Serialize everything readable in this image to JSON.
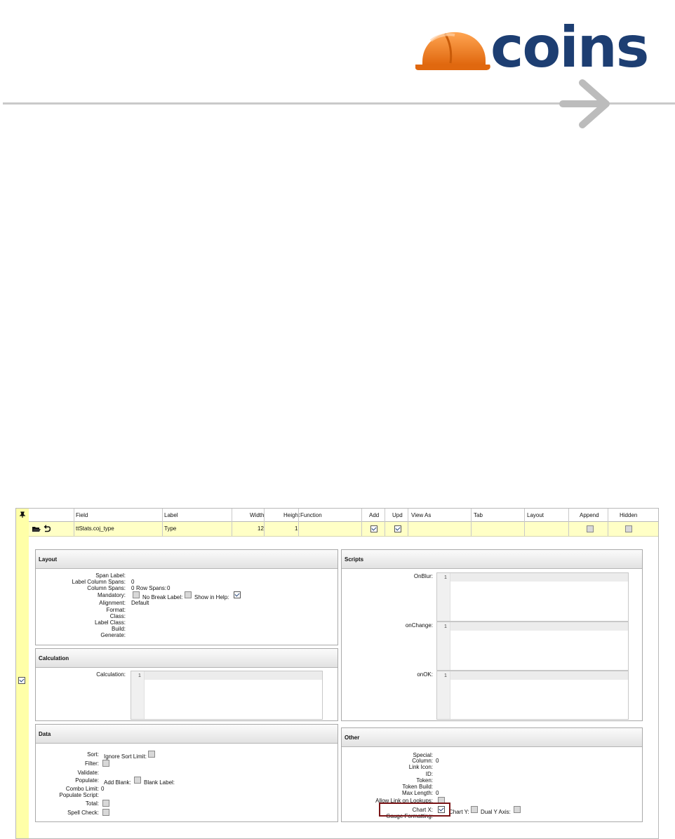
{
  "brand": {
    "logo_text": "coins",
    "accent": "#f07d1a",
    "navy": "#1d3e72"
  },
  "grid": {
    "columns": [
      "Field",
      "Label",
      "Width",
      "Height",
      "Function",
      "Add",
      "Upd",
      "View As",
      "Tab",
      "Layout",
      "Append",
      "Hidden"
    ],
    "row": {
      "field": "ttStats.coj_type",
      "label": "Type",
      "width": "12",
      "height": "1",
      "add": true,
      "upd": true,
      "append": false,
      "hidden": false
    }
  },
  "layout": {
    "title": "Layout",
    "span_label": "Span Label:",
    "label_col_spans": "Label Column Spans:",
    "label_col_spans_val": "0",
    "col_spans": "Column Spans:",
    "col_spans_val": "0",
    "row_spans": "Row Spans:",
    "row_spans_val": "0",
    "mandatory": "Mandatory:",
    "no_break": "No Break Label:",
    "show_help": "Show in Help:",
    "alignment": "Alignment:",
    "alignment_val": "Default",
    "format": "Format:",
    "class": "Class:",
    "label_class": "Label Class:",
    "build": "Build:",
    "generate": "Generate:"
  },
  "calculation": {
    "title": "Calculation",
    "label": "Calculation:",
    "line": "1"
  },
  "data": {
    "title": "Data",
    "sort": "Sort:",
    "ignore_sort": "Ignore Sort Limit:",
    "filter": "Filter:",
    "validate": "Validate:",
    "populate": "Populate:",
    "add_blank": "Add Blank:",
    "blank_label": "Blank Label:",
    "combo_limit": "Combo Limit:",
    "combo_limit_val": "0",
    "populate_script": "Populate Script:",
    "total": "Total:",
    "spell_check": "Spell Check:"
  },
  "scripts": {
    "title": "Scripts",
    "onblur": "OnBlur:",
    "onchange": "onChange:",
    "onok": "onOK:",
    "line": "1"
  },
  "other": {
    "title": "Other",
    "special": "Special:",
    "column": "Column:",
    "column_val": "0",
    "link_icon": "Link Icon:",
    "id": "ID:",
    "token": "Token:",
    "token_build": "Token Build:",
    "max_length": "Max Length:",
    "max_length_val": "0",
    "allow_link": "Allow Link on Lookups:",
    "chart_x": "Chart X:",
    "chart_y": "Chart Y:",
    "dual_y": "Dual Y Axis:",
    "gauge": "Gauge Formatting:"
  }
}
